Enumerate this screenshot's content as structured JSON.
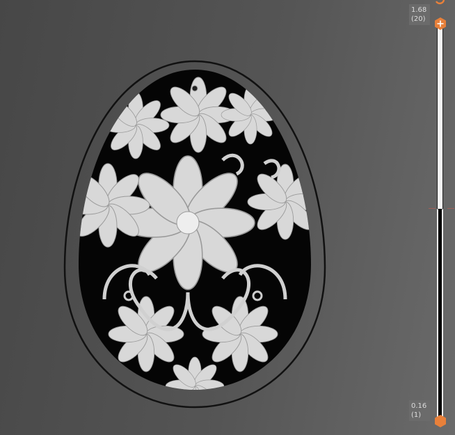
{
  "layer_slider": {
    "max_value": "1.68",
    "max_layer": "(20)",
    "min_value": "0.16",
    "min_layer": "(1)",
    "progress_fraction": 0.5,
    "accent_color": "#e8803a"
  }
}
